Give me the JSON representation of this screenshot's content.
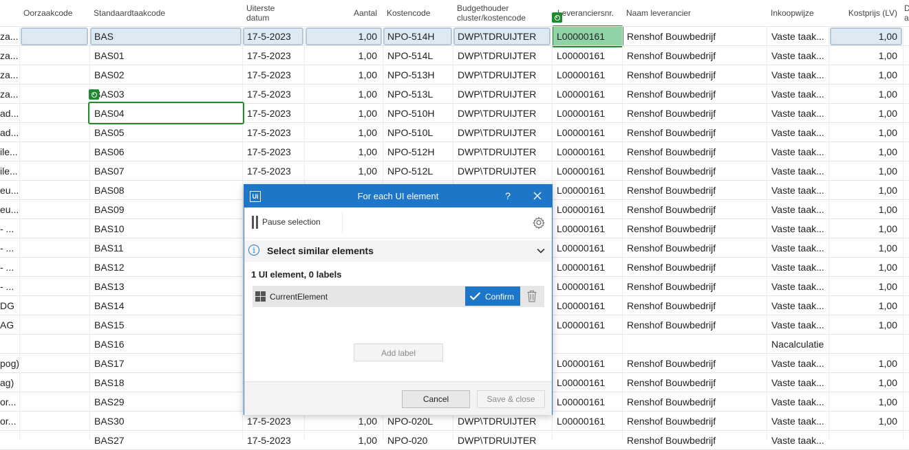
{
  "grid": {
    "headers": {
      "oorzaakcode": "Oorzaakcode",
      "standaardtaakcode": "Standaardtaakcode",
      "uiterste_datum": [
        "Uiterste",
        "datum"
      ],
      "aantal": "Aantal",
      "kostencode": "Kostencode",
      "budgethouder": [
        "Budgethouder",
        "cluster/kostencode"
      ],
      "leveranciersnr": "Leveranciersnr.",
      "naam_leverancier": "Naam leverancier",
      "inkoopwijze": "Inkoopwijze",
      "kostprijs": "Kostprijs (LV)",
      "extra": [
        "D",
        "a"
      ]
    },
    "rows": [
      {
        "c0": "za...",
        "oorz": "",
        "std": "BAS",
        "date": "17-5-2023",
        "aantal": "1,00",
        "kc": "NPO-514H",
        "bh": "DWP\\TDRUIJTER",
        "lnr": "L00000161",
        "naam": "Renshof Bouwbedrijf",
        "ink": "Vaste taak...",
        "kp": "1,00"
      },
      {
        "c0": "za...",
        "oorz": "",
        "std": "BAS01",
        "date": "17-5-2023",
        "aantal": "1,00",
        "kc": "NPO-514L",
        "bh": "DWP\\TDRUIJTER",
        "lnr": "L00000161",
        "naam": "Renshof Bouwbedrijf",
        "ink": "Vaste taak...",
        "kp": "1,00"
      },
      {
        "c0": "za...",
        "oorz": "",
        "std": "BAS02",
        "date": "17-5-2023",
        "aantal": "1,00",
        "kc": "NPO-513H",
        "bh": "DWP\\TDRUIJTER",
        "lnr": "L00000161",
        "naam": "Renshof Bouwbedrijf",
        "ink": "Vaste taak...",
        "kp": "1,00"
      },
      {
        "c0": "za...",
        "oorz": "",
        "std": "BAS03",
        "date": "17-5-2023",
        "aantal": "1,00",
        "kc": "NPO-513L",
        "bh": "DWP\\TDRUIJTER",
        "lnr": "L00000161",
        "naam": "Renshof Bouwbedrijf",
        "ink": "Vaste taak...",
        "kp": "1,00"
      },
      {
        "c0": "ad...",
        "oorz": "",
        "std": "BAS04",
        "date": "17-5-2023",
        "aantal": "1,00",
        "kc": "NPO-510H",
        "bh": "DWP\\TDRUIJTER",
        "lnr": "L00000161",
        "naam": "Renshof Bouwbedrijf",
        "ink": "Vaste taak...",
        "kp": "1,00"
      },
      {
        "c0": "ad...",
        "oorz": "",
        "std": "BAS05",
        "date": "17-5-2023",
        "aantal": "1,00",
        "kc": "NPO-510L",
        "bh": "DWP\\TDRUIJTER",
        "lnr": "L00000161",
        "naam": "Renshof Bouwbedrijf",
        "ink": "Vaste taak...",
        "kp": "1,00"
      },
      {
        "c0": "ile...",
        "oorz": "",
        "std": "BAS06",
        "date": "17-5-2023",
        "aantal": "1,00",
        "kc": "NPO-512H",
        "bh": "DWP\\TDRUIJTER",
        "lnr": "L00000161",
        "naam": "Renshof Bouwbedrijf",
        "ink": "Vaste taak...",
        "kp": "1,00"
      },
      {
        "c0": "ile...",
        "oorz": "",
        "std": "BAS07",
        "date": "17-5-2023",
        "aantal": "1,00",
        "kc": "NPO-512L",
        "bh": "DWP\\TDRUIJTER",
        "lnr": "L00000161",
        "naam": "Renshof Bouwbedrijf",
        "ink": "Vaste taak...",
        "kp": "1,00"
      },
      {
        "c0": "eu...",
        "oorz": "",
        "std": "BAS08",
        "date": "",
        "aantal": "",
        "kc": "",
        "bh": "",
        "lnr": "L00000161",
        "naam": "Renshof Bouwbedrijf",
        "ink": "Vaste taak...",
        "kp": "1,00"
      },
      {
        "c0": "eu...",
        "oorz": "",
        "std": "BAS09",
        "date": "",
        "aantal": "",
        "kc": "",
        "bh": "",
        "lnr": "L00000161",
        "naam": "Renshof Bouwbedrijf",
        "ink": "Vaste taak...",
        "kp": "1,00"
      },
      {
        "c0": "- ...",
        "oorz": "",
        "std": "BAS10",
        "date": "",
        "aantal": "",
        "kc": "",
        "bh": "",
        "lnr": "L00000161",
        "naam": "Renshof Bouwbedrijf",
        "ink": "Vaste taak...",
        "kp": "1,00"
      },
      {
        "c0": "- ...",
        "oorz": "",
        "std": "BAS11",
        "date": "",
        "aantal": "",
        "kc": "",
        "bh": "",
        "lnr": "L00000161",
        "naam": "Renshof Bouwbedrijf",
        "ink": "Vaste taak...",
        "kp": "1,00"
      },
      {
        "c0": "- ...",
        "oorz": "",
        "std": "BAS12",
        "date": "",
        "aantal": "",
        "kc": "",
        "bh": "",
        "lnr": "L00000161",
        "naam": "Renshof Bouwbedrijf",
        "ink": "Vaste taak...",
        "kp": "1,00"
      },
      {
        "c0": "- ...",
        "oorz": "",
        "std": "BAS13",
        "date": "",
        "aantal": "",
        "kc": "",
        "bh": "",
        "lnr": "L00000161",
        "naam": "Renshof Bouwbedrijf",
        "ink": "Vaste taak...",
        "kp": "1,00"
      },
      {
        "c0": "DG",
        "oorz": "",
        "std": "BAS14",
        "date": "",
        "aantal": "",
        "kc": "",
        "bh": "",
        "lnr": "L00000161",
        "naam": "Renshof Bouwbedrijf",
        "ink": "Vaste taak...",
        "kp": "1,00"
      },
      {
        "c0": "AG",
        "oorz": "",
        "std": "BAS15",
        "date": "",
        "aantal": "",
        "kc": "",
        "bh": "",
        "lnr": "L00000161",
        "naam": "Renshof Bouwbedrijf",
        "ink": "Vaste taak...",
        "kp": "1,00"
      },
      {
        "c0": "",
        "oorz": "",
        "std": "BAS16",
        "date": "",
        "aantal": "",
        "kc": "",
        "bh": "",
        "lnr": "",
        "naam": "",
        "ink": "Nacalculatie",
        "kp": ""
      },
      {
        "c0": "pog)",
        "oorz": "",
        "std": "BAS17",
        "date": "",
        "aantal": "",
        "kc": "",
        "bh": "",
        "lnr": "L00000161",
        "naam": "Renshof Bouwbedrijf",
        "ink": "Vaste taak...",
        "kp": "1,00"
      },
      {
        "c0": "ag)",
        "oorz": "",
        "std": "BAS18",
        "date": "",
        "aantal": "",
        "kc": "",
        "bh": "",
        "lnr": "L00000161",
        "naam": "Renshof Bouwbedrijf",
        "ink": "Vaste taak...",
        "kp": "1,00"
      },
      {
        "c0": "or...",
        "oorz": "",
        "std": "BAS29",
        "date": "",
        "aantal": "",
        "kc": "",
        "bh": "",
        "lnr": "L00000161",
        "naam": "Renshof Bouwbedrijf",
        "ink": "Vaste taak...",
        "kp": "1,00"
      },
      {
        "c0": "or...",
        "oorz": "",
        "std": "BAS30",
        "date": "17-5-2023",
        "aantal": "1,00",
        "kc": "NPO-020L",
        "bh": "DWP\\TDRUIJTER",
        "lnr": "L00000161",
        "naam": "Renshof Bouwbedrijf",
        "ink": "Vaste taak...",
        "kp": "1,00"
      },
      {
        "c0": "",
        "oorz": "",
        "std": "BAS27",
        "date": "17-5-2023",
        "aantal": "1,00",
        "kc": "NPO-020",
        "bh": "DWP\\TDRUIJTER",
        "lnr": "",
        "naam": "Renshof Bouwbedrijf",
        "ink": "Vaste taak...",
        "kp": ""
      }
    ]
  },
  "dialog": {
    "title": "For each UI element",
    "help": "?",
    "pause_label": "Pause selection",
    "section_title": "Select similar elements",
    "count_label": "1 UI element, 0 labels",
    "element_name": "CurrentElement",
    "confirm_label": "Confirm",
    "add_label": "Add label",
    "cancel_label": "Cancel",
    "save_label": "Save & close",
    "logo_text": "Ui"
  },
  "colors": {
    "accent": "#1e76c8",
    "selection_green": "#1f8a2e",
    "selection_fill": "#8fd3a6",
    "edit_row": "#ddeaf3"
  }
}
